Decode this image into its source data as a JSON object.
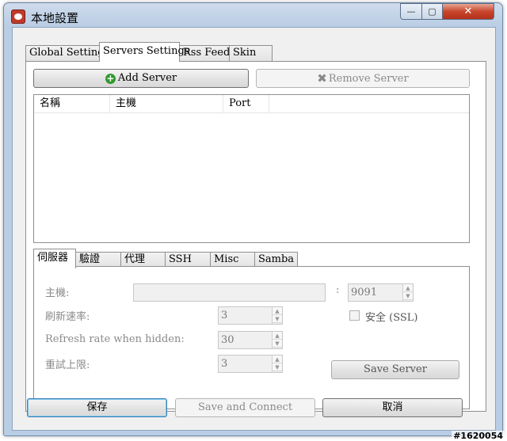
{
  "window": {
    "title": "本地設置",
    "minimize_glyph": "—",
    "maximize_glyph": "▢",
    "close_glyph": "✕"
  },
  "tabs": [
    "Global Settings",
    "Servers Settings",
    "Rss Feeds",
    "Skin"
  ],
  "active_tab": "Servers Settings",
  "toolbar": {
    "add_server": "Add Server",
    "remove_server": "Remove Server"
  },
  "server_list": {
    "columns": [
      "名稱",
      "主機",
      "Port"
    ],
    "rows": []
  },
  "subtabs": [
    "伺服器",
    "驗證",
    "代理",
    "SSH",
    "Misc",
    "Samba"
  ],
  "active_subtab": "伺服器",
  "server_form": {
    "host_label": "主機:",
    "host_value": "",
    "port_separator": ":",
    "port_value": "9091",
    "refresh_label": "刷新速率:",
    "refresh_value": "3",
    "refresh_hidden_label": "Refresh rate when hidden:",
    "refresh_hidden_value": "30",
    "retry_label": "重試上限:",
    "retry_value": "3",
    "ssl_label": "安全 (SSL)",
    "ssl_checked": false,
    "save_server": "Save Server"
  },
  "footer": {
    "save": "保存",
    "save_connect": "Save and Connect",
    "cancel": "取消"
  },
  "watermark": "#1620054",
  "icons": {
    "app": "app-icon",
    "add": "plus-icon",
    "remove": "x-icon",
    "spin_up": "▲",
    "spin_down": "▼"
  }
}
